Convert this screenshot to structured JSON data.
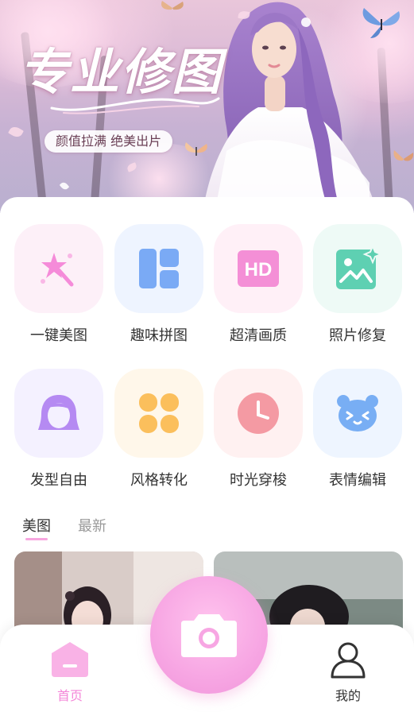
{
  "banner": {
    "title": "专业修图",
    "subtitle": "颜值拉满  绝美出片"
  },
  "tools": [
    {
      "label": "一键美图",
      "icon": "magic-wand-icon",
      "bg": "#fdf0f8",
      "color": "#f58bd9"
    },
    {
      "label": "趣味拼图",
      "icon": "collage-layout-icon",
      "bg": "#eef4ff",
      "color": "#7aaaf5"
    },
    {
      "label": "超清画质",
      "icon": "hd-icon",
      "bg": "#fff0f7",
      "color": "#f48fd6"
    },
    {
      "label": "照片修复",
      "icon": "image-repair-icon",
      "bg": "#eefaf6",
      "color": "#5ed0b2"
    },
    {
      "label": "发型自由",
      "icon": "hairstyle-icon",
      "bg": "#f4f1ff",
      "color": "#b58af2"
    },
    {
      "label": "风格转化",
      "icon": "clover-icon",
      "bg": "#fff7ea",
      "color": "#fbbf5c"
    },
    {
      "label": "时光穿梭",
      "icon": "clock-icon",
      "bg": "#fff1f1",
      "color": "#f49aa3"
    },
    {
      "label": "表情编辑",
      "icon": "bear-face-icon",
      "bg": "#eef5ff",
      "color": "#78aef4"
    }
  ],
  "tabs": [
    {
      "label": "美图",
      "active": true
    },
    {
      "label": "最新",
      "active": false
    }
  ],
  "nav": {
    "home_label": "首页",
    "profile_label": "我的",
    "home_color": "#f486d8",
    "profile_color": "#333333"
  },
  "colors": {
    "accent": "#f7a6df"
  }
}
